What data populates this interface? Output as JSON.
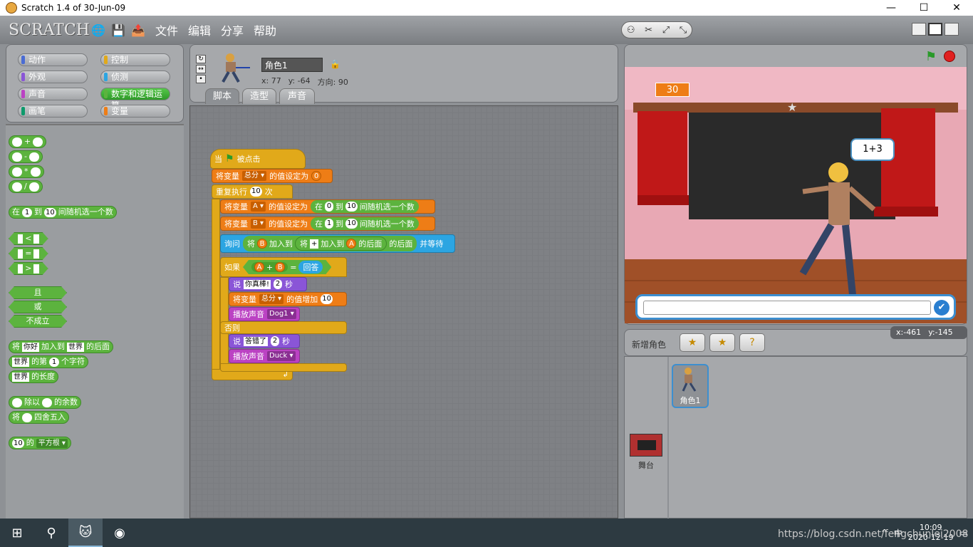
{
  "window": {
    "title": "Scratch 1.4 of 30-Jun-09",
    "controls": [
      "—",
      "☐",
      "✕"
    ]
  },
  "menubar": {
    "logo": "SCRATCH",
    "items": [
      "文件",
      "编辑",
      "分享",
      "帮助"
    ]
  },
  "categories": [
    {
      "label": "动作",
      "color": "#4a6cd4"
    },
    {
      "label": "控制",
      "color": "#e1a91a"
    },
    {
      "label": "外观",
      "color": "#8a55d7"
    },
    {
      "label": "侦测",
      "color": "#2ca5e2"
    },
    {
      "label": "声音",
      "color": "#bb42c3"
    },
    {
      "label": "数字和逻辑运算",
      "color": "#5cb33e"
    },
    {
      "label": "画笔",
      "color": "#0e9a6c"
    },
    {
      "label": "变量",
      "color": "#ee7d16"
    }
  ],
  "palette": {
    "plus": "+",
    "minus": "-",
    "times": "*",
    "divide": "/",
    "random": {
      "pre": "在",
      "a": "1",
      "mid": "到",
      "b": "10",
      "post": "间随机选一个数"
    },
    "lt": "<",
    "eq": "=",
    "gt": ">",
    "and": "且",
    "or": "或",
    "not": "不成立",
    "join": {
      "pre": "将",
      "a": "你好",
      "mid": "加入到",
      "b": "世界",
      "post": "的后面"
    },
    "letter": {
      "a": "世界",
      "mid": "的第",
      "n": "1",
      "post": "个字符"
    },
    "length": {
      "a": "世界",
      "post": "的长度"
    },
    "mod": {
      "mid": "除以",
      "post": "的余数"
    },
    "round": {
      "pre": "将",
      "post": "四舍五入"
    },
    "sqrt": {
      "n": "10",
      "mid": "的",
      "fn": "平方根"
    }
  },
  "sprite": {
    "name": "角色1",
    "x_label": "x:",
    "x": "77",
    "y_label": "y:",
    "y": "-64",
    "dir_label": "方向:",
    "dir": "90"
  },
  "tabs": [
    "脚本",
    "造型",
    "声音"
  ],
  "script": {
    "hat": {
      "pre": "当",
      "post": "被点击"
    },
    "set_total": {
      "pre": "将变量",
      "var": "总分",
      "mid": "的值设定为",
      "val": "0"
    },
    "repeat": {
      "pre": "重复执行",
      "n": "10",
      "post": "次"
    },
    "set_a": {
      "pre": "将变量",
      "var": "A",
      "mid": "的值设定为",
      "r_pre": "在",
      "a": "0",
      "r_mid": "到",
      "b": "10",
      "r_post": "间随机选一个数"
    },
    "set_b": {
      "pre": "将变量",
      "var": "B",
      "mid": "的值设定为",
      "r_pre": "在",
      "a": "1",
      "r_mid": "到",
      "b": "10",
      "r_post": "间随机选一个数"
    },
    "ask": {
      "pre": "询问",
      "j1": "将",
      "v1": "B",
      "m1": "加入到",
      "j2": "将",
      "s2": "+",
      "m2": "加入到",
      "v2": "A",
      "p2": "的后面",
      "p1": "的后面",
      "post": "并等待"
    },
    "if": {
      "pre": "如果",
      "a": "A",
      "plus": "+",
      "b": "B",
      "eq": "=",
      "answer": "回答"
    },
    "say1": {
      "pre": "说",
      "text": "你真棒!",
      "n": "2",
      "post": "秒"
    },
    "change": {
      "pre": "将变量",
      "var": "总分",
      "mid": "的值增加",
      "val": "10"
    },
    "sound1": {
      "pre": "播放声音",
      "name": "Dog1"
    },
    "else": "否则",
    "say2": {
      "pre": "说",
      "text": "答错了",
      "n": "2",
      "post": "秒"
    },
    "sound2": {
      "pre": "播放声音",
      "name": "Duck"
    }
  },
  "stage": {
    "score": "30",
    "bubble": "1+3",
    "mouse_x_label": "x:",
    "mouse_x": "-461",
    "mouse_y_label": "y:",
    "mouse_y": "-145"
  },
  "new_sprite": {
    "label": "新增角色"
  },
  "sprites": [
    {
      "name": "角色1"
    }
  ],
  "stage_thumb": {
    "name": "舞台"
  },
  "taskbar": {
    "time": "10:09",
    "date": "2020-12-19",
    "ime": "中",
    "watermark": "https://blog.csdn.net/fengchunlei2008"
  }
}
